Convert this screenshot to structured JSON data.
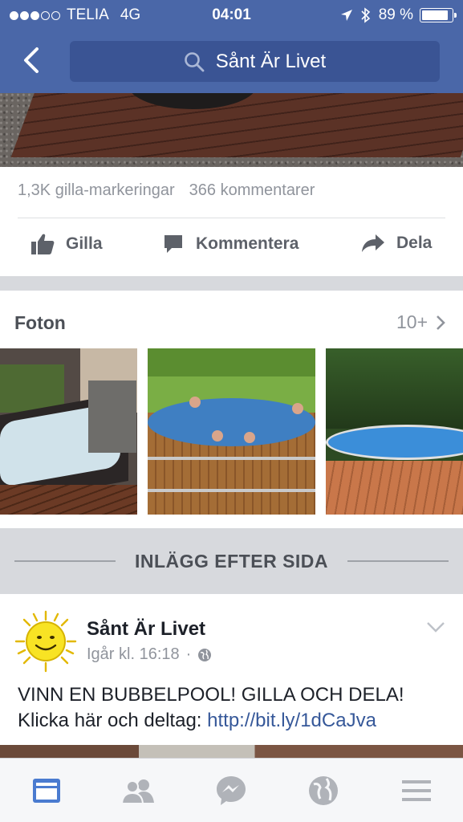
{
  "status_bar": {
    "carrier": "TELIA",
    "network": "4G",
    "time": "04:01",
    "battery_text": "89 %",
    "battery_level": 0.89,
    "signal_bars": 3,
    "signal_total": 5
  },
  "nav": {
    "search_text": "Sånt Är Livet"
  },
  "post_stats": {
    "likes": "1,3K gilla-markeringar",
    "comments": "366 kommentarer"
  },
  "actions": {
    "like": "Gilla",
    "comment": "Kommentera",
    "share": "Dela"
  },
  "photos": {
    "title": "Foton",
    "count": "10+"
  },
  "section": {
    "title": "INLÄGG EFTER SIDA"
  },
  "post": {
    "author": "Sånt Är Livet",
    "timestamp": "Igår kl. 16:18",
    "separator": "·",
    "line1": "VINN EN BUBBELPOOL! GILLA OCH DELA!",
    "line2_prefix": "Klicka här och deltag: ",
    "link": "http://bit.ly/1dCaJva"
  },
  "tabbar": {
    "items": [
      "news-feed",
      "friends",
      "messenger",
      "notifications",
      "more"
    ],
    "active": "news-feed"
  },
  "colors": {
    "header": "#4a67a8",
    "search_bg": "#3a5494",
    "active_tab": "#4a7bd0",
    "inactive_tab": "#b0b3b9",
    "link": "#365899"
  }
}
